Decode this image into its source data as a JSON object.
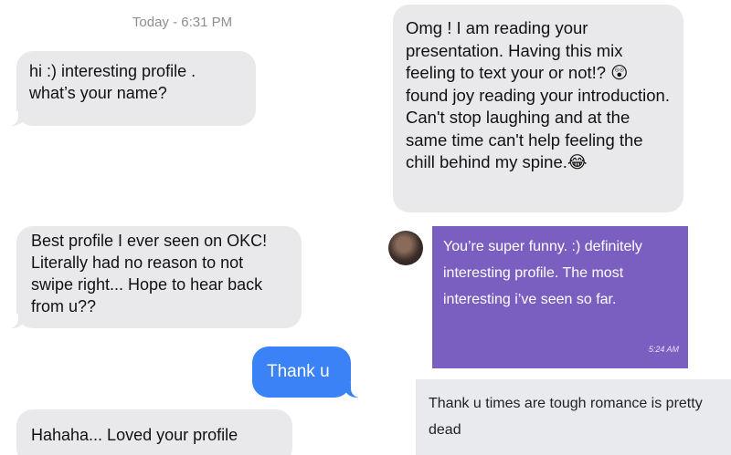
{
  "panel1": {
    "timestamp": "Today - 6:31 PM",
    "incoming": [
      "hi :) interesting profile .",
      "what’s your name?"
    ]
  },
  "panel2": {
    "message": "Omg ! I am reading your presentation. Having this mix feeling to text your or not!? 😲 found joy reading your introduction. Can't stop laughing and at the same time can't help feeling the chill behind my spine.😂"
  },
  "panel3": {
    "incoming": "Best profile I ever seen on OKC! Literally had no reason to not swipe right... Hope to hear back from u??",
    "outgoing": "Thank u",
    "incoming2": "Hahaha... Loved your profile"
  },
  "panel4": {
    "incoming": "You’re super funny. :) definitely interesting profile. The most interesting i’ve seen so far.",
    "incoming_time": "5:24 AM",
    "reply": "Thank u times are tough romance is pretty dead"
  }
}
